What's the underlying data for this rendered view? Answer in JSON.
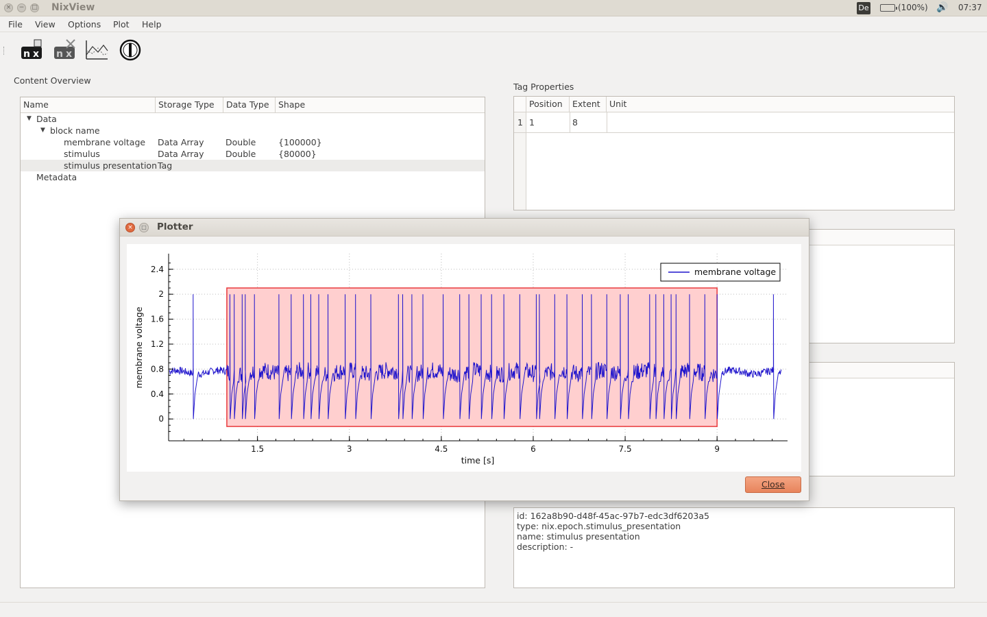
{
  "window": {
    "title": "NixView"
  },
  "system_tray": {
    "keyboard": "De",
    "battery": "(100%)",
    "clock": "07:37"
  },
  "menu": [
    "File",
    "View",
    "Options",
    "Plot",
    "Help"
  ],
  "toolbar": {
    "icons": [
      "nix-open-icon",
      "nix-close-icon",
      "plot-icon",
      "power-icon"
    ]
  },
  "content_overview": {
    "label": "Content Overview",
    "columns": [
      "Name",
      "Storage Type",
      "Data Type",
      "Shape"
    ],
    "rows": [
      {
        "name": "Data",
        "storage": "",
        "dtype": "",
        "shape": ""
      },
      {
        "name": "block name",
        "storage": "",
        "dtype": "",
        "shape": ""
      },
      {
        "name": "membrane voltage",
        "storage": "Data Array",
        "dtype": "Double",
        "shape": "{100000}"
      },
      {
        "name": "stimulus",
        "storage": "Data Array",
        "dtype": "Double",
        "shape": "{80000}"
      },
      {
        "name": "stimulus presentation",
        "storage": "Tag",
        "dtype": "",
        "shape": ""
      },
      {
        "name": "Metadata",
        "storage": "",
        "dtype": "",
        "shape": ""
      }
    ]
  },
  "tag_properties": {
    "label": "Tag Properties",
    "columns": [
      "Position",
      "Extent",
      "Unit"
    ],
    "rows": [
      {
        "index": "1",
        "position": "1",
        "extent": "8",
        "unit": ""
      }
    ]
  },
  "info": {
    "id": "id: 162a8b90-d48f-45ac-97b7-edc3df6203a5",
    "type": "type: nix.epoch.stimulus_presentation",
    "name": "name: stimulus presentation",
    "description": "description: -"
  },
  "plotter": {
    "title": "Plotter",
    "close_label": "Close",
    "colors": {
      "trace": "#1f14cc",
      "tag_fill": "#ffcfcf",
      "tag_border": "#e8393c"
    },
    "chart_data": {
      "type": "line",
      "xlabel": "time [s]",
      "ylabel": "membrane voltage",
      "xlim": [
        0.05,
        10.15
      ],
      "ylim": [
        -0.35,
        2.65
      ],
      "xticks": [
        1.5,
        3,
        4.5,
        6,
        7.5,
        9
      ],
      "xtick_labels": [
        "1.5",
        "3",
        "4.5",
        "6",
        "7.5",
        "9"
      ],
      "yticks": [
        0,
        0.4,
        0.8,
        1.2,
        1.6,
        2,
        2.4
      ],
      "ytick_labels": [
        "0",
        "0.4",
        "0.8",
        "1.2",
        "1.6",
        "2",
        "2.4"
      ],
      "grid": true,
      "legend": "top-right",
      "series": [
        {
          "name": "membrane voltage",
          "baseline": 0.75,
          "spike_peak": 2.0,
          "spike_trough": 0.0,
          "spike_times": [
            0.45,
            1.05,
            1.12,
            1.25,
            1.3,
            1.45,
            1.85,
            2.05,
            2.25,
            2.37,
            2.5,
            2.65,
            2.93,
            3.1,
            3.35,
            3.8,
            3.87,
            4.02,
            4.2,
            4.53,
            4.8,
            4.95,
            5.15,
            5.32,
            5.52,
            5.78,
            6.05,
            6.1,
            6.35,
            6.55,
            6.8,
            6.95,
            7.2,
            7.42,
            7.55,
            7.9,
            8.0,
            8.13,
            8.25,
            8.33,
            8.55,
            8.8,
            9.0,
            9.92
          ]
        }
      ],
      "tag": {
        "position": 1,
        "extent": 8,
        "ymin": -0.12,
        "ymax": 2.1
      }
    }
  }
}
